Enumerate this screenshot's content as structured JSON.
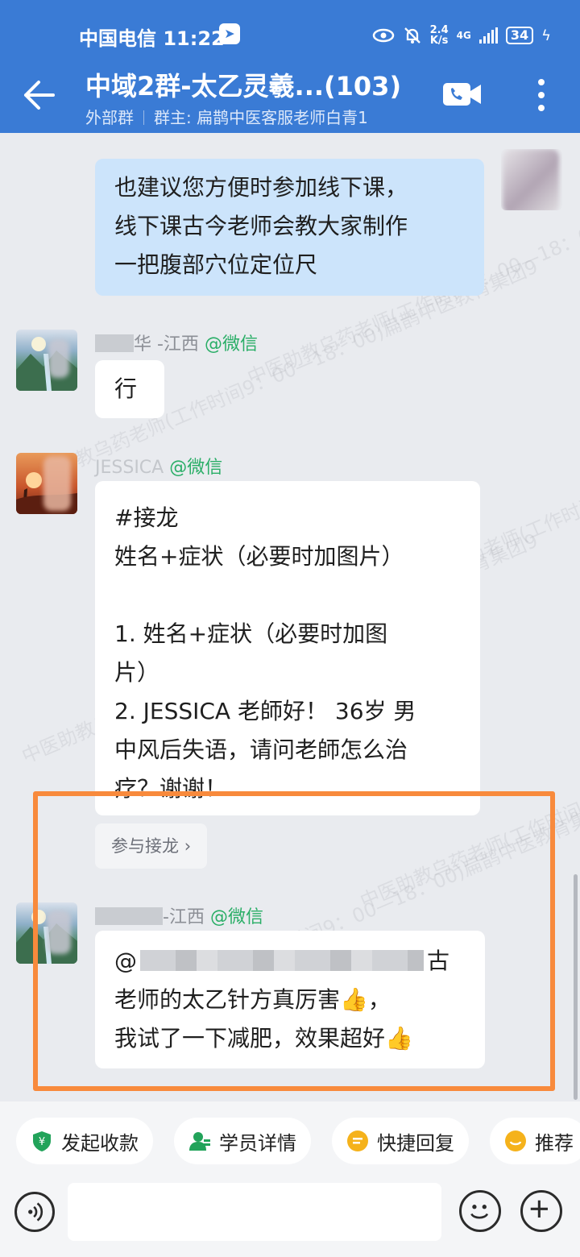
{
  "status_bar": {
    "carrier": "中国电信",
    "time": "11:22",
    "net_speed_value": "2.4",
    "net_speed_unit": "K/s",
    "network": "4G",
    "battery": "34"
  },
  "header": {
    "title": "中域2群-太乙灵羲...(103)",
    "group_type": "外部群",
    "owner": "群主: 扁鹊中医客服老师白青1"
  },
  "watermark_text": "中医助教乌药老师(工作时间9：00—18：00)扁鹊中医教育集团9",
  "messages": [
    {
      "from_self": true,
      "lines": [
        "也建议您方便时参加线下课，",
        "线下课古今老师会教大家制作",
        "一把腹部穴位定位尺"
      ]
    },
    {
      "sender_name": "华 -江西",
      "sender_tag": "@微信",
      "lines": [
        "行"
      ]
    },
    {
      "sender_name": "JESSICA",
      "sender_tag": "@微信",
      "lines": [
        "#接龙",
        "姓名+症状（必要时加图片）",
        "",
        "1. 姓名+症状（必要时加图",
        "片）",
        "2. JESSICA 老師好！ 36岁 男",
        "中风后失语，请问老師怎么治",
        "疗？谢谢！"
      ],
      "action_label": "参与接龙"
    },
    {
      "sender_name": "-江西",
      "sender_tag": "@微信",
      "first_line_prefix": "@",
      "first_line_suffix": "古",
      "lines": [
        "老师的太乙针方真厉害👍，",
        "我试了一下减肥，效果超好👍"
      ]
    }
  ],
  "quick_actions": [
    {
      "label": "发起收款",
      "icon": "payment-icon",
      "color": "#22a35a"
    },
    {
      "label": "学员详情",
      "icon": "student-icon",
      "color": "#22a35a"
    },
    {
      "label": "快捷回复",
      "icon": "quick-reply-icon",
      "color": "#f5b21b"
    },
    {
      "label": "推荐",
      "icon": "recommend-icon",
      "color": "#f5b21b"
    }
  ],
  "input": {
    "placeholder": "",
    "value": ""
  },
  "colors": {
    "header": "#3a7bd5",
    "highlight": "#f88a3c",
    "self_bubble": "#cce4fb",
    "tag_green": "#2aae67"
  }
}
